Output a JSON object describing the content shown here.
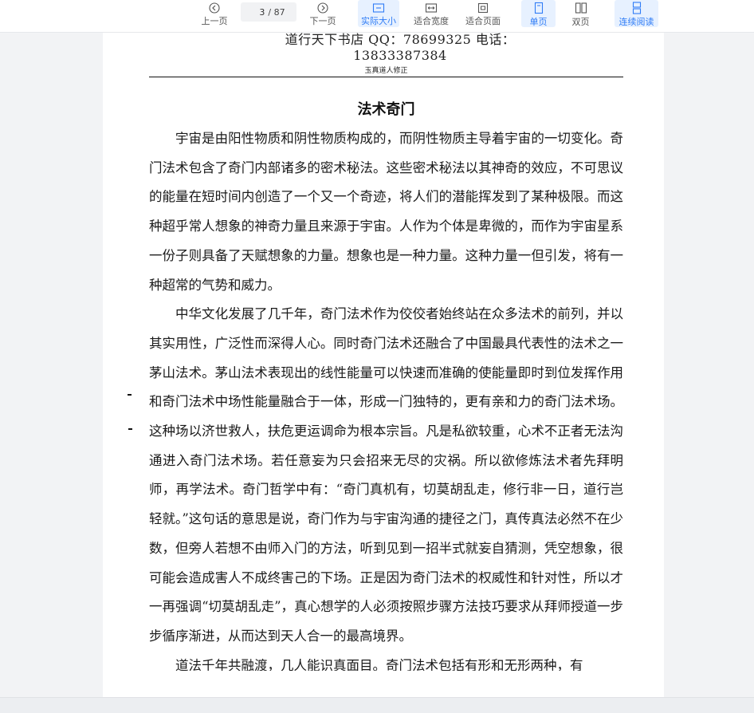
{
  "toolbar": {
    "prev_label": "上一页",
    "page_current": "3",
    "page_total": "/ 87",
    "next_label": "下一页",
    "actual_size_label": "实际大小",
    "fit_width_label": "适合宽度",
    "fit_page_label": "适合页面",
    "single_page_label": "单页",
    "double_page_label": "双页",
    "continuous_label": "连续阅读"
  },
  "page": {
    "header": "道行天下书店  QQ：78699325  电话：13833387384",
    "subheader": "玉真道人修正",
    "title": "法术奇门",
    "paragraphs": [
      "宇宙是由阳性物质和阴性物质构成的，而阴性物质主导着宇宙的一切变化。奇门法术包含了奇门内部诸多的密术秘法。这些密术秘法以其神奇的效应，不可思议的能量在短时间内创造了一个又一个奇迹，将人们的潜能挥发到了某种极限。而这种超乎常人想象的神奇力量且来源于宇宙。人作为个体是卑微的，而作为宇宙星系一份子则具备了天赋想象的力量。想象也是一种力量。这种力量一但引发，将有一种超常的气势和威力。",
      "中华文化发展了几千年，奇门法术作为佼佼者始终站在众多法术的前列，并以其实用性，广泛性而深得人心。同时奇门法术还融合了中国最具代表性的法术之一茅山法术。茅山法术表现出的线性能量可以快速而准确的使能量即时到位发挥作用和奇门法术中场性能量融合于一体，形成一门独特的，更有亲和力的奇门法术场。这种场以济世救人，扶危更运调命为根本宗旨。凡是私欲较重，心术不正者无法沟通进入奇门法术场。若任意妄为只会招来无尽的灾祸。所以欲修炼法术者先拜明师，再学法术。奇门哲学中有：“奇门真机有，切莫胡乱走，修行非一日，道行岂轻就。”这句话的意思是说，奇门作为与宇宙沟通的捷径之门，真传真法必然不在少数，但旁人若想不由师入门的方法，听到见到一招半式就妄自猜测，凭空想象，很可能会造成害人不成终害己的下场。正是因为奇门法术的权威性和针对性，所以才一再强调“切莫胡乱走”，真心想学的人必须按照步骤方法技巧要求从拜师授道一步步循序渐进，从而达到天人合一的最高境界。",
      "道法千年共融渡，几人能识真面目。奇门法术包括有形和无形两种，有"
    ]
  }
}
